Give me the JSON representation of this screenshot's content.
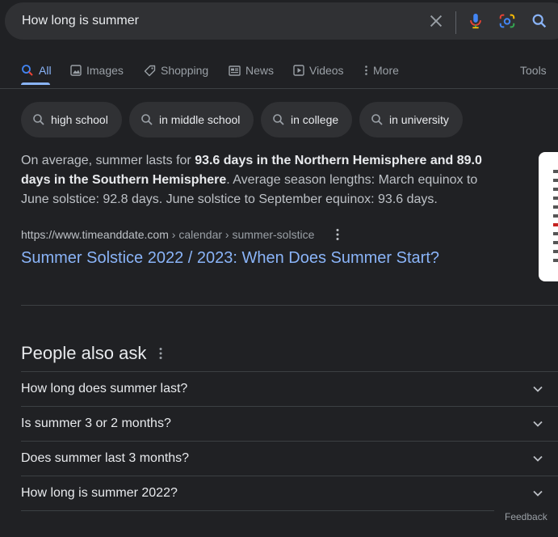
{
  "search": {
    "query": "How long is summer",
    "clear_icon": "close-icon",
    "voice_icon": "microphone-icon",
    "lens_icon": "camera-lens-icon",
    "search_icon": "search-icon"
  },
  "tabs": [
    {
      "label": "All",
      "icon": "search-icon",
      "active": true
    },
    {
      "label": "Images",
      "icon": "image-icon"
    },
    {
      "label": "Shopping",
      "icon": "tag-icon"
    },
    {
      "label": "News",
      "icon": "newspaper-icon"
    },
    {
      "label": "Videos",
      "icon": "play-icon"
    },
    {
      "label": "More",
      "icon": "vertical-dots-icon"
    }
  ],
  "tools_label": "Tools",
  "chips": [
    {
      "label": "high school"
    },
    {
      "label": "in middle school"
    },
    {
      "label": "in college"
    },
    {
      "label": "in university"
    }
  ],
  "snippet": {
    "pre": "On average, summer lasts for ",
    "bold": "93.6 days in the Northern Hemisphere and 89.0 days in the Southern Hemisphere",
    "post": ". Average season lengths: March equinox to June solstice: 92.8 days. June solstice to September equinox: 93.6 days."
  },
  "result": {
    "site": "https://www.timeanddate.com",
    "path": " › calendar › summer-solstice",
    "title": "Summer Solstice 2022 / 2023: When Does Summer Start?"
  },
  "paa": {
    "heading": "People also ask",
    "questions": [
      "How long does summer last?",
      "Is summer 3 or 2 months?",
      "Does summer last 3 months?",
      "How long is summer 2022?"
    ]
  },
  "feedback_label": "Feedback",
  "colors": {
    "background": "#202124",
    "surface": "#303134",
    "link": "#8ab4f8",
    "text": "#e8eaed",
    "muted": "#9aa0a6"
  }
}
